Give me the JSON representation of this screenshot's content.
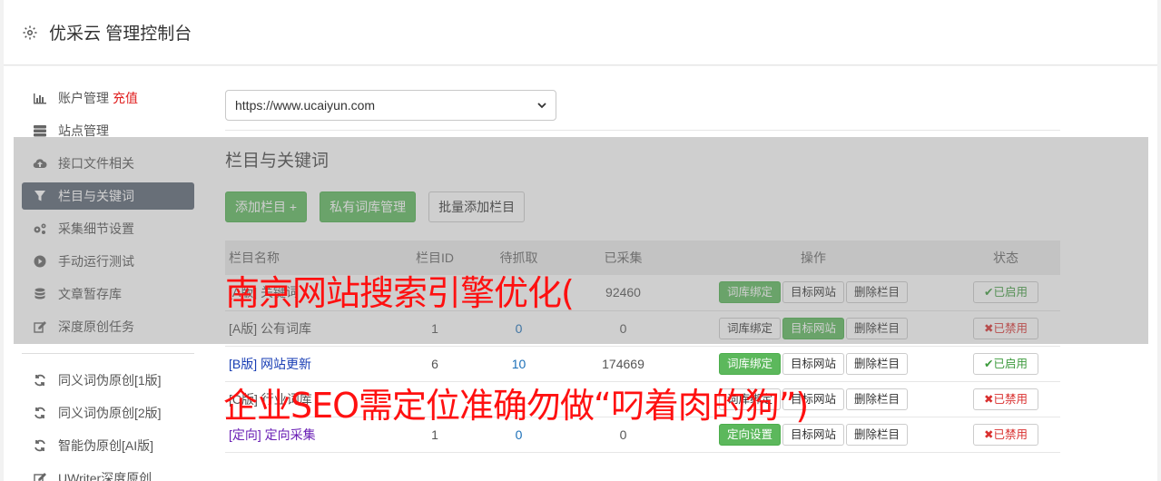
{
  "header": {
    "title": "优采云 管理控制台"
  },
  "sidebar": {
    "group1": [
      {
        "label": "账户管理",
        "extra": "充值",
        "icon": "bar-chart-icon"
      },
      {
        "label": "站点管理",
        "icon": "server-icon"
      },
      {
        "label": "接口文件相关",
        "icon": "cloud-upload-icon"
      },
      {
        "label": "栏目与关键词",
        "icon": "filter-icon",
        "active": true
      },
      {
        "label": "采集细节设置",
        "icon": "gears-icon"
      },
      {
        "label": "手动运行测试",
        "icon": "play-circle-icon"
      },
      {
        "label": "文章暂存库",
        "icon": "database-icon"
      },
      {
        "label": "深度原创任务",
        "icon": "edit-icon"
      }
    ],
    "group2": [
      {
        "label": "同义词伪原创[1版]",
        "icon": "refresh-icon"
      },
      {
        "label": "同义词伪原创[2版]",
        "icon": "refresh-icon"
      },
      {
        "label": "智能伪原创[AI版]",
        "icon": "refresh-icon"
      },
      {
        "label": "UWriter深度原创",
        "icon": "edit-icon"
      }
    ]
  },
  "main": {
    "site_select": "https://www.ucaiyun.com",
    "section_title": "栏目与关键词",
    "buttons": {
      "add": "添加栏目 +",
      "private": "私有词库管理",
      "batch": "批量添加栏目"
    },
    "table": {
      "headers": [
        "栏目名称",
        "栏目ID",
        "待抓取",
        "已采集",
        "操作",
        "状态"
      ],
      "rows": [
        {
          "name": "[A版] 关键词",
          "id": "",
          "pending": "",
          "collected": "92460",
          "ops": [
            "词库绑定",
            "目标网站",
            "删除栏目"
          ],
          "ops_green": [
            0
          ],
          "status": "已启用",
          "status_on": true
        },
        {
          "name": "[A版] 公有词库",
          "id": "1",
          "pending": "0",
          "collected": "0",
          "ops": [
            "词库绑定",
            "目标网站",
            "删除栏目"
          ],
          "ops_green": [
            1
          ],
          "status": "已禁用",
          "status_on": false
        },
        {
          "name": "[B版] 网站更新",
          "id": "6",
          "pending": "10",
          "collected": "174669",
          "ops": [
            "词库绑定",
            "目标网站",
            "删除栏目"
          ],
          "ops_green": [
            0
          ],
          "status": "已启用",
          "status_on": true
        },
        {
          "name": "[C版] 行业词库",
          "id": "",
          "pending": "",
          "collected": "",
          "ops": [
            "词库绑定",
            "目标网站",
            "删除栏目"
          ],
          "ops_green": [],
          "status": "已禁用",
          "status_on": false
        },
        {
          "name": "[定向] 定向采集",
          "id": "1",
          "pending": "0",
          "collected": "0",
          "ops": [
            "定向设置",
            "目标网站",
            "删除栏目"
          ],
          "ops_green": [
            0
          ],
          "status": "已禁用",
          "status_on": false
        }
      ]
    }
  },
  "watermark": {
    "line1": "南京网站搜索引擎优化(",
    "line2": "企业SEO需定位准确勿做“叼着肉的狗”)"
  },
  "colors": {
    "accent_green": "#5cb85c",
    "active_nav": "#5a6473",
    "watermark": "#ff1010"
  }
}
